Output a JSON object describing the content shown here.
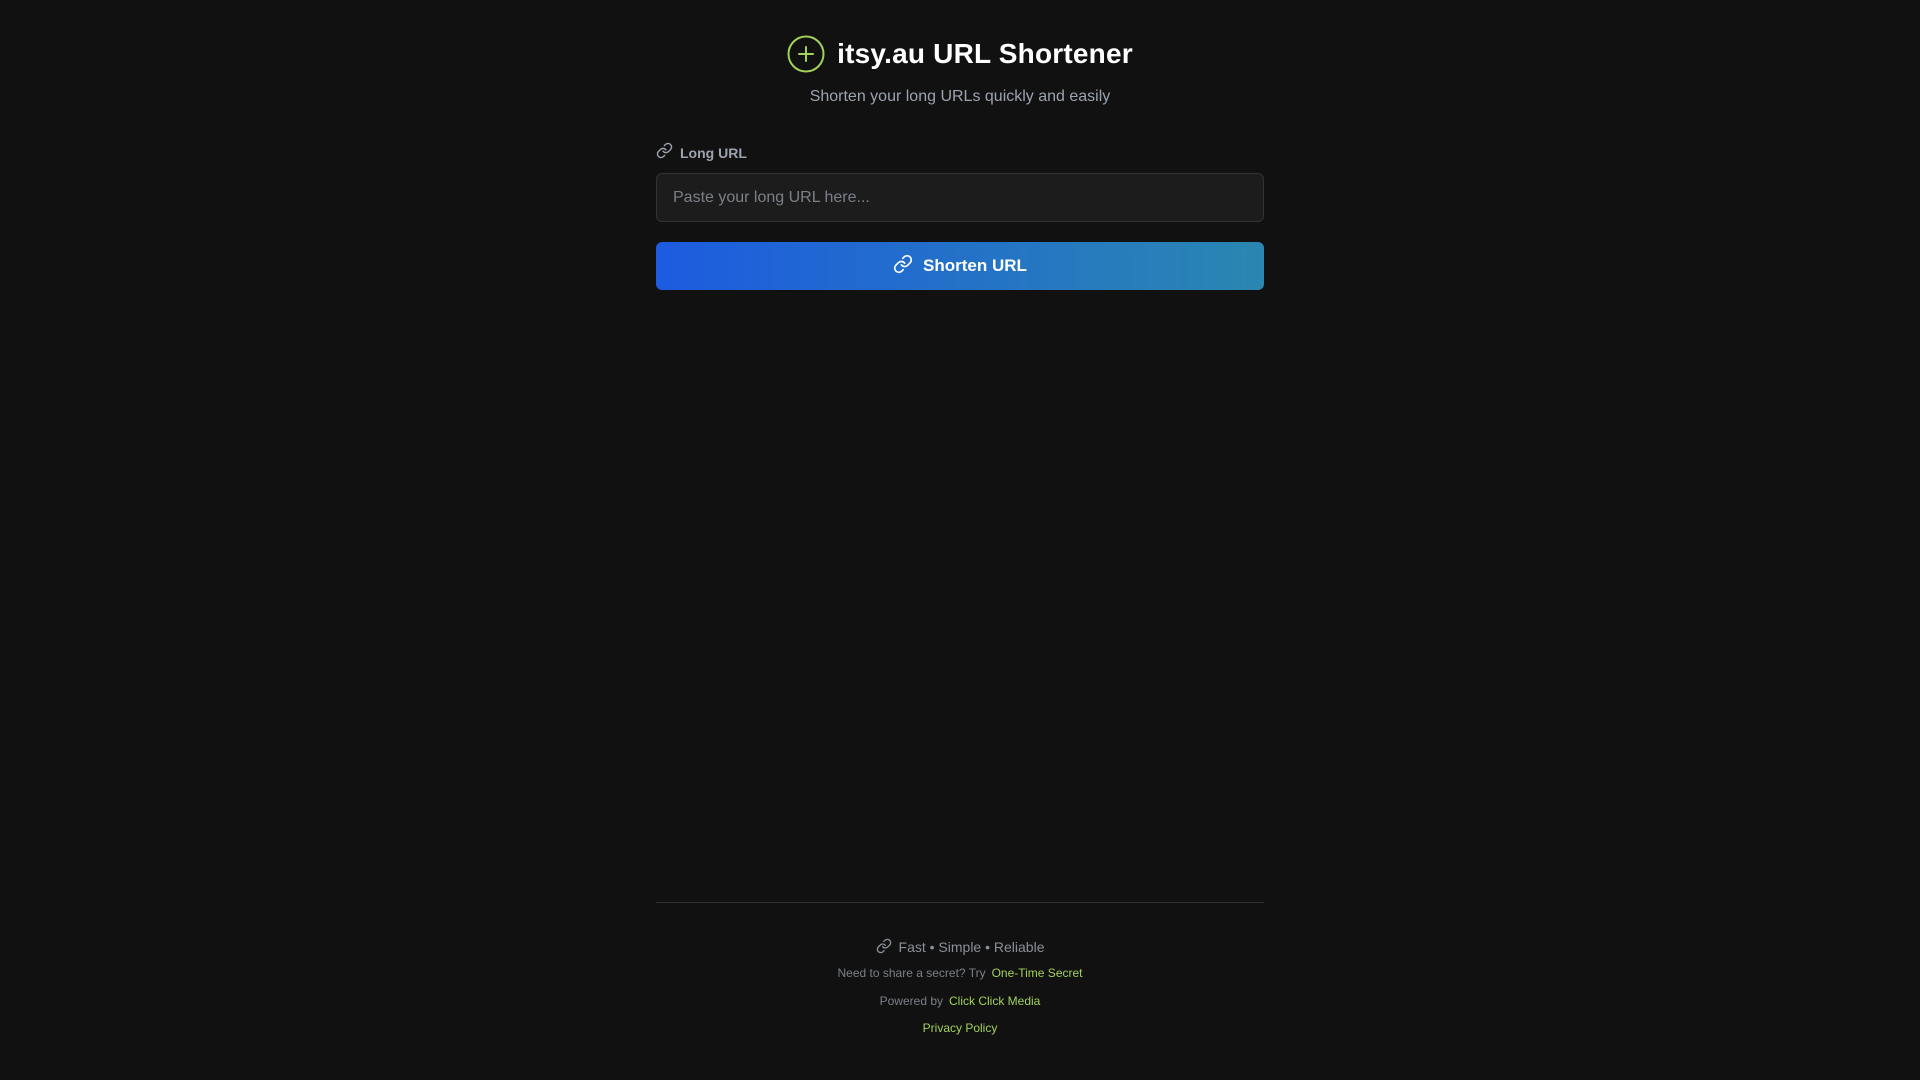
{
  "app": {
    "title": "itsy.au URL Shortener",
    "subtitle": "Shorten your long URLs quickly and easily",
    "logo_icon": "plus-circle-icon",
    "accent_color": "#a3d15a"
  },
  "form": {
    "label": "Long URL",
    "label_icon": "link-icon",
    "input_value": "",
    "input_placeholder": "Paste your long URL here...",
    "submit_label": "Shorten URL",
    "submit_icon": "link-icon",
    "submit_gradient": [
      "#1d5be0",
      "#2a87b0"
    ]
  },
  "footer": {
    "tagline": "Fast • Simple • Reliable",
    "tagline_icon": "link-icon",
    "secret_text": "Need to share a secret? Try",
    "secret_link": "One-Time Secret",
    "powered_text": "Powered by",
    "powered_link": "Click Click Media",
    "privacy_link": "Privacy Policy"
  }
}
